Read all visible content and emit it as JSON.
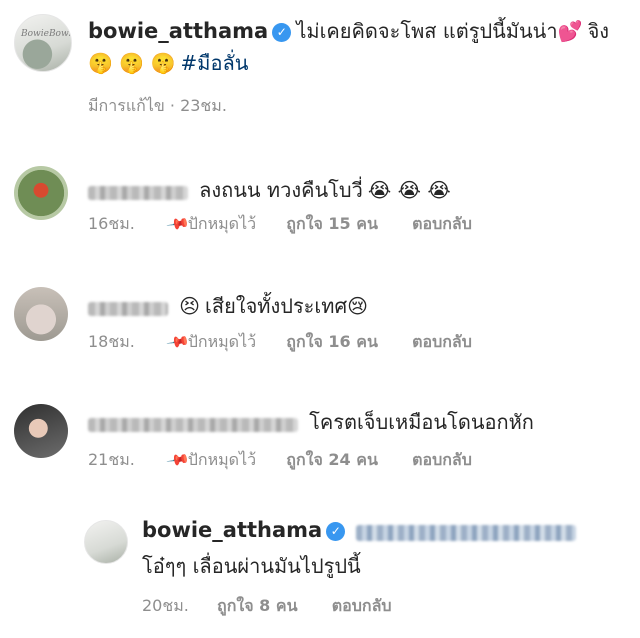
{
  "post": {
    "username": "bowie_atthama",
    "verified_mark": "✓",
    "caption_line1": "ไม่เคยคิดจะโพส แต่รูปนี้มันน่า",
    "caption_heart": "💕",
    "caption_tail": "จิง",
    "caption_emojis": "🤫 🤫 🤫",
    "hashtag": "#มือลั่น",
    "edited_label": "มีการแก้ไข",
    "time": "23ชม.",
    "avatar_text": "BowieBowie"
  },
  "comments": [
    {
      "text": "ลงถนน ทวงคืนโบวี่",
      "emojis": "😭 😭 😭",
      "time": "16ชม.",
      "pin_label": "ปักหมุดไว้",
      "likes": "ถูกใจ 15 คน",
      "reply_label": "ตอบกลับ"
    },
    {
      "emoji_start": "😣",
      "text": "เสียใจทั้งประเทศ",
      "emoji_end": "😢",
      "time": "18ชม.",
      "pin_label": "ปักหมุดไว้",
      "likes": "ถูกใจ 16 คน",
      "reply_label": "ตอบกลับ"
    },
    {
      "text": "โครตเจ็บเหมือนโดนอกหัก",
      "time": "21ชม.",
      "pin_label": "ปักหมุดไว้",
      "likes": "ถูกใจ 24 คน",
      "reply_label": "ตอบกลับ"
    }
  ],
  "reply": {
    "username": "bowie_atthama",
    "verified_mark": "✓",
    "text": "โอ๋ๆๆ เลื่อนผ่านมันไปรูปนี้",
    "time": "20ชม.",
    "likes": "ถูกใจ 8 คน",
    "reply_label": "ตอบกลับ"
  },
  "icons": {
    "pin": "📌",
    "verified": "verified-badge-icon"
  },
  "colors": {
    "text": "#262626",
    "meta": "#8e8e8e",
    "hashtag": "#00376b",
    "verified": "#3897f0"
  }
}
